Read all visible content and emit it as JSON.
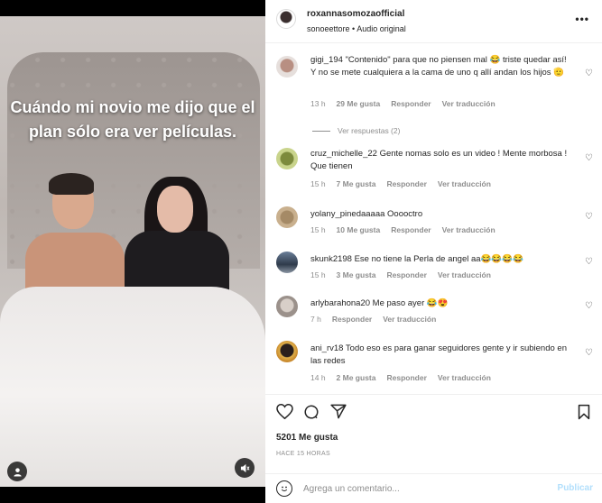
{
  "post": {
    "caption": "Cuándo mi novio me dijo que el plan sólo era ver películas."
  },
  "header": {
    "username": "roxannasomozaofficial",
    "audio": "sonoeettore • Audio original",
    "more": "•••"
  },
  "comments": [
    {
      "user": "gigi_194",
      "text": "\"Contenido\" para que no piensen mal 😂 triste quedar así! Y no se mete cualquiera a la cama de uno q allí andan los hijos 🫡",
      "time": "13 h",
      "likes": "29 Me gusta",
      "reply": "Responder",
      "translate": "Ver traducción",
      "view_replies": "Ver respuestas (2)"
    },
    {
      "user": "cruz_michelle_22",
      "text": "Gente nomas solo es un video ! Mente morbosa ! Que tienen",
      "time": "15 h",
      "likes": "7 Me gusta",
      "reply": "Responder",
      "translate": "Ver traducción"
    },
    {
      "user": "yolany_pinedaaaaa",
      "text": "Ooooctro",
      "time": "15 h",
      "likes": "10 Me gusta",
      "reply": "Responder",
      "translate": "Ver traducción"
    },
    {
      "user": "skunk2198",
      "text": "Ese no tiene la Perla de angel aa😂😂😂😂",
      "time": "15 h",
      "likes": "3 Me gusta",
      "reply": "Responder",
      "translate": "Ver traducción"
    },
    {
      "user": "arlybarahona20",
      "text": "Me paso ayer 😂😍",
      "time": "7 h",
      "reply": "Responder",
      "translate": "Ver traducción"
    },
    {
      "user": "ani_rv18",
      "text": "Todo eso es para ganar seguidores gente y ir subiendo en las redes",
      "time": "14 h",
      "likes": "2 Me gusta",
      "reply": "Responder",
      "translate": "Ver traducción"
    }
  ],
  "footer": {
    "likes": "5201 Me gusta",
    "time_ago": "HACE 15 HORAS",
    "comment_placeholder": "Agrega un comentario...",
    "publish": "Publicar"
  },
  "colors": {
    "link_disabled": "#b2dffc",
    "secondary_text": "#8e8e8e",
    "primary_text": "#262626"
  }
}
